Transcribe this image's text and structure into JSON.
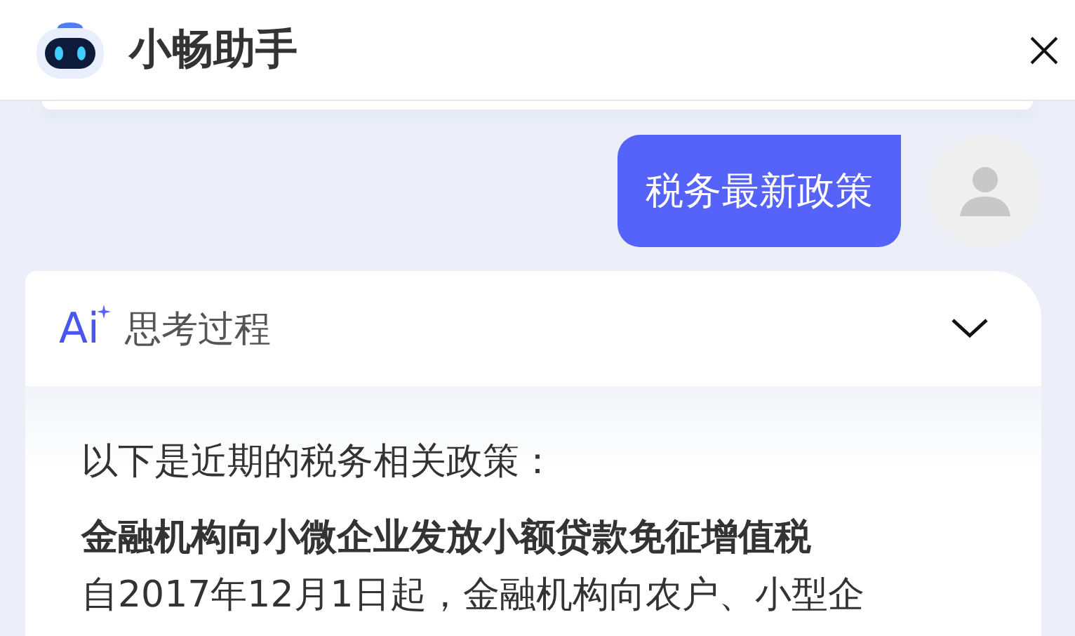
{
  "header": {
    "title": "小畅助手"
  },
  "messages": [
    {
      "kind": "user",
      "text": "税务最新政策"
    },
    {
      "kind": "assistant",
      "thinking": {
        "ai_badge": "Ai",
        "label": "思考过程",
        "expanded": false
      },
      "paragraphs": [
        {
          "kind": "text",
          "text": "以下是近期的税务相关政策："
        },
        {
          "kind": "heading",
          "text": "金融机构向小微企业发放小额贷款免征增值税"
        },
        {
          "kind": "text",
          "text": "自2017年12月1日起，金融机构向农户、小型企"
        }
      ]
    }
  ]
}
